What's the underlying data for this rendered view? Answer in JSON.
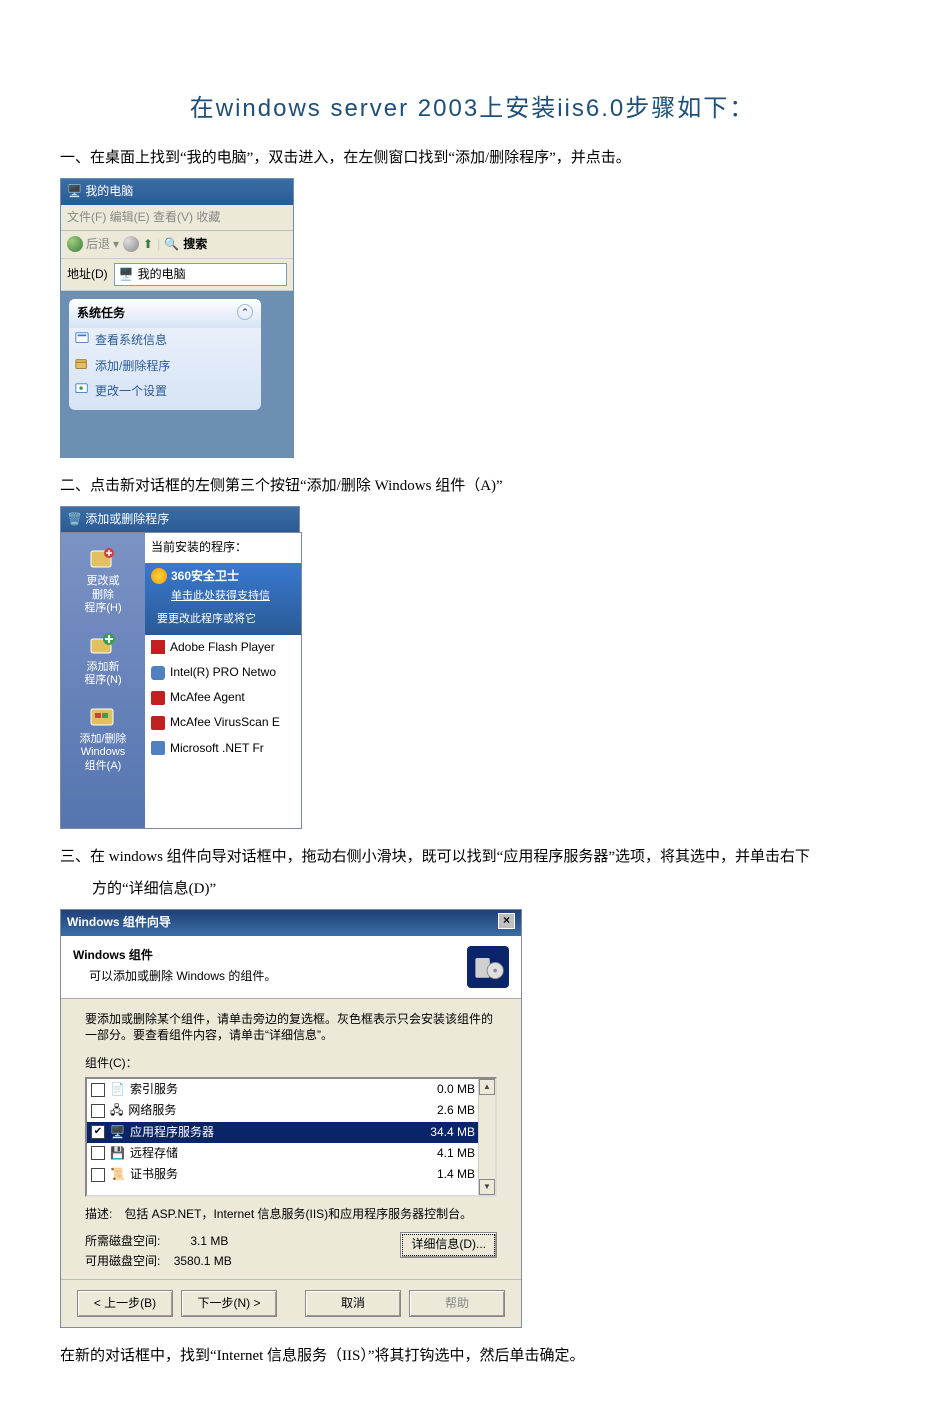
{
  "title": "在windows server 2003上安装iis6.0步骤如下：",
  "step1": "一、在桌面上找到“我的电脑”，双击进入，在左侧窗口找到“添加/删除程序”，并点击。",
  "step2": "二、点击新对话框的左侧第三个按钮“添加/删除 Windows 组件（A)”",
  "step3_a": "三、在 windows 组件向导对话框中，拖动右侧小滑块，既可以找到“应用程序服务器”选项，将其选中，并单击右下",
  "step3_b": "方的“详细信息(D)”",
  "step4": "在新的对话框中，找到“Internet 信息服务（IIS）”将其打钩选中，然后单击确定。",
  "fig1": {
    "title": "我的电脑",
    "menu": "文件(F)  编辑(E)  查看(V)  收藏",
    "back": "后退",
    "search": "搜索",
    "addr_label": "地址(D)",
    "addr_value": "我的电脑",
    "task_header": "系统任务",
    "chev": "⌃",
    "links": [
      "查看系统信息",
      "添加/删除程序",
      "更改一个设置"
    ]
  },
  "fig2": {
    "title": "添加或删除程序",
    "sb1": "更改或\n删除\n程序(H)",
    "sb2": "添加新\n程序(N)",
    "sb3": "添加/删除\nWindows\n组件(A)",
    "header": "当前安装的程序：",
    "sel_name": "360安全卫士",
    "sel_support": "单击此处获得支持信",
    "sel_change": "要更改此程序或将它",
    "rows": [
      "Adobe Flash Player",
      "Intel(R) PRO Netwo",
      "McAfee Agent",
      "McAfee VirusScan E",
      "Microsoft .NET Fr"
    ]
  },
  "fig3": {
    "title": "Windows 组件向导",
    "close": "×",
    "h1": "Windows 组件",
    "h2": "可以添加或删除 Windows 的组件。",
    "instr": "要添加或删除某个组件，请单击旁边的复选框。灰色框表示只会安装该组件的一部分。要查看组件内容，请单击“详细信息”。",
    "list_label": "组件(C)：",
    "items": [
      {
        "name": "索引服务",
        "size": "0.0 MB",
        "checked": false,
        "sel": false
      },
      {
        "name": "网络服务",
        "size": "2.6 MB",
        "checked": false,
        "sel": false
      },
      {
        "name": "应用程序服务器",
        "size": "34.4 MB",
        "checked": true,
        "sel": true
      },
      {
        "name": "远程存储",
        "size": "4.1 MB",
        "checked": false,
        "sel": false
      },
      {
        "name": "证书服务",
        "size": "1.4 MB",
        "checked": false,
        "sel": false
      }
    ],
    "desc_label": "描述:",
    "desc": "包括 ASP.NET，Internet 信息服务(IIS)和应用程序服务器控制台。",
    "space_req_label": "所需磁盘空间:",
    "space_req": "3.1 MB",
    "space_avail_label": "可用磁盘空间:",
    "space_avail": "3580.1 MB",
    "details_btn": "详细信息(D)...",
    "btn_back": "< 上一步(B)",
    "btn_next": "下一步(N) >",
    "btn_cancel": "取消",
    "btn_help": "帮助"
  }
}
